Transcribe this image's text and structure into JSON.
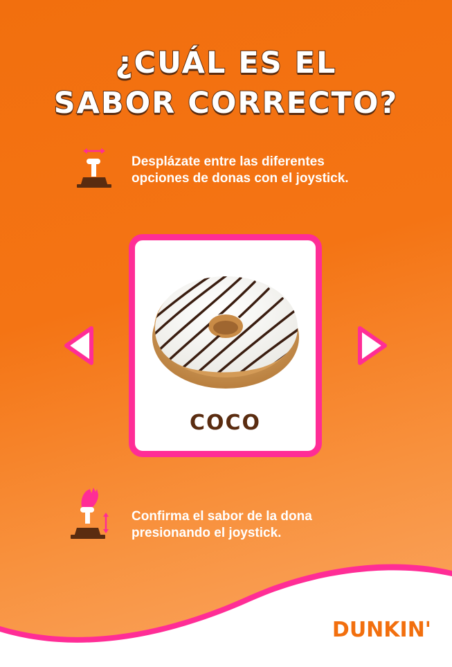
{
  "title": {
    "line1": "¿CUÁL ES EL",
    "line2": "SABOR CORRECTO?"
  },
  "instruction_navigate": {
    "line1": "Desplázate entre las diferentes",
    "line2": "opciones de donas con el joystick.",
    "icon": "joystick-left-right-icon"
  },
  "card": {
    "flavor": "COCO",
    "image": "donut-image"
  },
  "navigation": {
    "prev_icon": "triangle-left-icon",
    "next_icon": "triangle-right-icon"
  },
  "instruction_confirm": {
    "line1": "Confirma el sabor de la dona",
    "line2": "presionando el joystick.",
    "icon": "joystick-press-icon"
  },
  "brand": {
    "logo": "DUNKIN'"
  },
  "colors": {
    "orange": "#f26f0e",
    "pink": "#ff2d96",
    "brown": "#5a2c10",
    "white": "#ffffff"
  }
}
